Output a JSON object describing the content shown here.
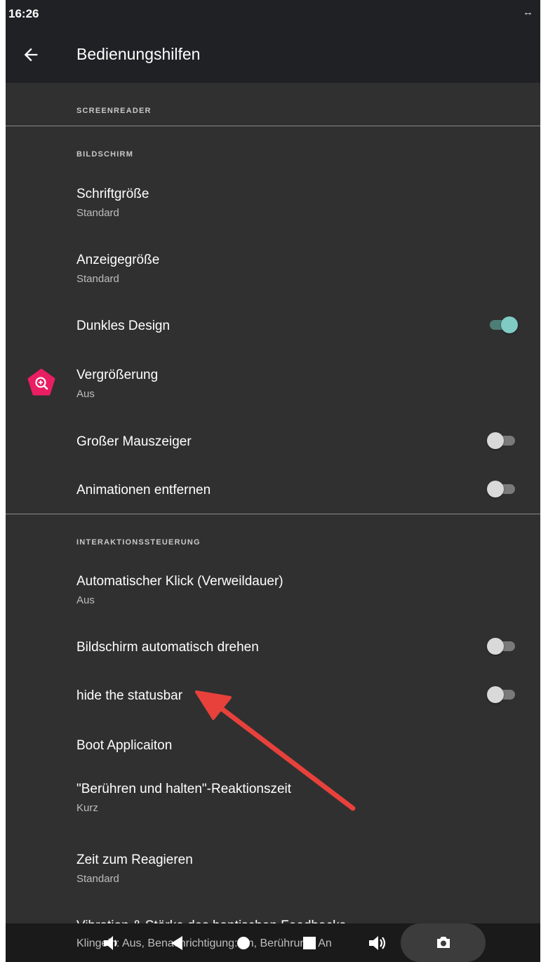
{
  "status": {
    "time": "16:26",
    "sync_icon": "sync-arrows-icon"
  },
  "appbar": {
    "title": "Bedienungshilfen"
  },
  "sections": {
    "screenreader": "SCREENREADER",
    "bildschirm": "BILDSCHIRM",
    "interaktion": "INTERAKTIONSSTEUERUNG"
  },
  "items": {
    "schriftgroesse": {
      "title": "Schriftgröße",
      "sub": "Standard"
    },
    "anzeigegroesse": {
      "title": "Anzeigegröße",
      "sub": "Standard"
    },
    "dunkles_design": {
      "title": "Dunkles Design",
      "on": true
    },
    "vergroesserung": {
      "title": "Vergrößerung",
      "sub": "Aus"
    },
    "mauszeiger": {
      "title": "Großer Mauszeiger",
      "on": false
    },
    "animationen": {
      "title": "Animationen entfernen",
      "on": false
    },
    "autoklick": {
      "title": "Automatischer Klick (Verweildauer)",
      "sub": "Aus"
    },
    "drehen": {
      "title": "Bildschirm automatisch drehen",
      "on": false
    },
    "statusbar": {
      "title": "hide the statusbar",
      "on": false
    },
    "boot": {
      "title": "Boot Applicaiton"
    },
    "beruehren": {
      "title": "\"Berühren und halten\"-Reaktionszeit",
      "sub": "Kurz"
    },
    "reagieren": {
      "title": "Zeit zum Reagieren",
      "sub": "Standard"
    },
    "vibration": {
      "title": "Vibration & Stärke des haptischen Feedbacks",
      "sub": "Klingeln: Aus, Benachrichtigung: An, Berührung: An"
    }
  },
  "colors": {
    "accent": "#80cbc4",
    "annotation_arrow": "#e8413c",
    "magnify_icon_bg": "#e91e63"
  }
}
